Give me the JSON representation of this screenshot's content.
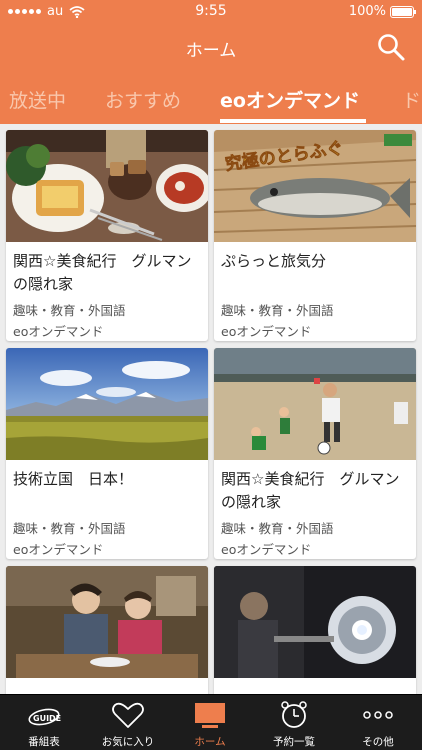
{
  "status_bar": {
    "carrier": "au",
    "time": "9:55",
    "battery": "100%"
  },
  "header": {
    "title": "ホーム"
  },
  "tabs": [
    {
      "label": "放送中"
    },
    {
      "label": "おすすめ"
    },
    {
      "label": "eoオンデマンド"
    },
    {
      "label": "ド"
    }
  ],
  "cards": [
    {
      "title": "関西☆美食紀行　グルマンの隠れ家",
      "category": "趣味・教育・外国語",
      "source": "eoオンデマンド"
    },
    {
      "title": "ぷらっと旅気分",
      "category": "趣味・教育・外国語",
      "source": "eoオンデマンド",
      "thumb_text": "究極のとらふぐ"
    },
    {
      "title": "技術立国　日本！",
      "category": "趣味・教育・外国語",
      "source": "eoオンデマンド"
    },
    {
      "title": "関西☆美食紀行　グルマンの隠れ家",
      "category": "趣味・教育・外国語",
      "source": "eoオンデマンド"
    },
    {
      "title": "",
      "category": "",
      "source": ""
    },
    {
      "title": "",
      "category": "",
      "source": ""
    }
  ],
  "tab_bar": [
    {
      "label": "番組表",
      "icon_text": "GUIDE"
    },
    {
      "label": "お気に入り"
    },
    {
      "label": "ホーム"
    },
    {
      "label": "予約一覧"
    },
    {
      "label": "その他"
    }
  ],
  "colors": {
    "accent": "#ee7e4d",
    "tab_bar_bg": "#1c1c1c"
  }
}
